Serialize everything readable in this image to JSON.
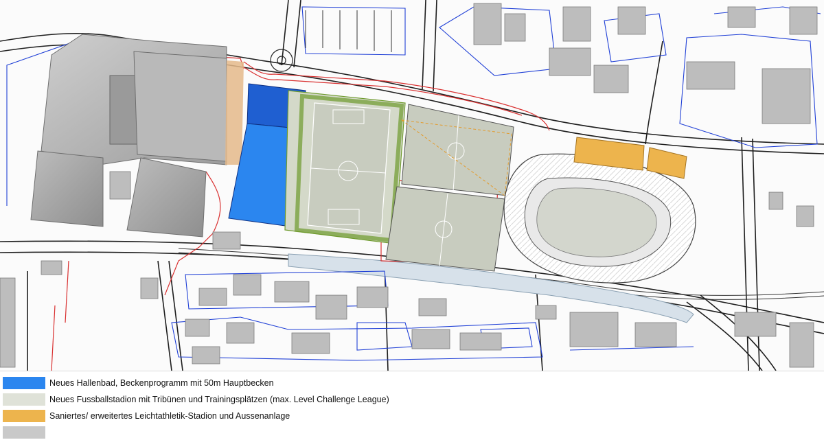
{
  "legend": {
    "items": [
      {
        "color": "#2b86ef",
        "label": "Neues Hallenbad, Beckenprogramm mit 50m Hauptbecken"
      },
      {
        "color": "#dfe2d8",
        "label": "Neues Fussballstadion mit Tribünen und Trainingsplätzen (max. Level Challenge League)"
      },
      {
        "color": "#edb44d",
        "label": "Saniertes/ erweitertes Leichtathletik-Stadion und Aussenanlage"
      },
      {
        "color": "#c9c9c9",
        "label": ""
      }
    ]
  },
  "map": {
    "zone_colors": {
      "hallenbad": "#2b86ef",
      "hallenbad_dark": "#1f5fd1",
      "fussballstadion": "#c8ccbf",
      "leichtathletik": "#edb44d",
      "pitch_green": "#6e9a2c",
      "building_grey": "#a9a9a9",
      "road_line": "#222222",
      "parcel_blue": "#1f3fd6",
      "plan_red": "#d93030"
    }
  }
}
